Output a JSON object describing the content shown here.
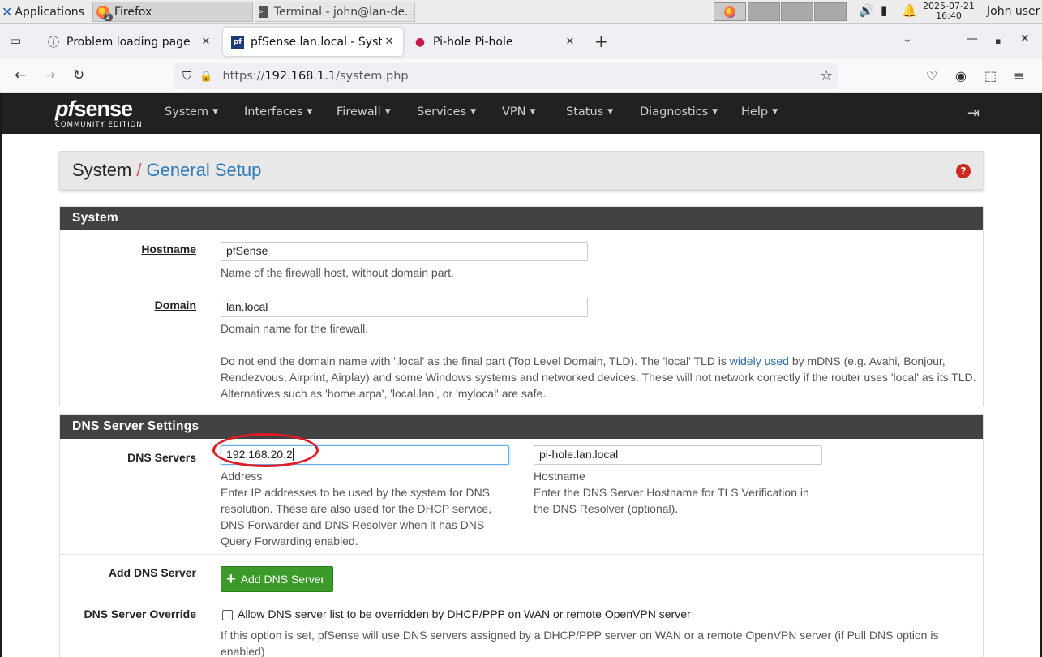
{
  "taskbar": {
    "apps_label": "Applications",
    "firefox_label": "Firefox",
    "firefox_count": "2",
    "terminal_label": "Terminal - john@lan-de...",
    "date": "2025-07-21",
    "time": "16:40",
    "user": "John user"
  },
  "browser": {
    "tabs": [
      {
        "title": "Problem loading page"
      },
      {
        "title": "pfSense.lan.local - System"
      },
      {
        "title": "Pi-hole Pi-hole"
      }
    ],
    "url_prefix": "https://",
    "url_host": "192.168.1.1",
    "url_path": "/system.php"
  },
  "pfsense": {
    "logo_word_a": "pf",
    "logo_word_b": "sense",
    "logo_edition": "COMMUNITY EDITION",
    "menu": [
      "System",
      "Interfaces",
      "Firewall",
      "Services",
      "VPN",
      "Status",
      "Diagnostics",
      "Help"
    ],
    "breadcrumb_parent": "System",
    "breadcrumb_sep": "/",
    "breadcrumb_current": "General Setup"
  },
  "system_panel": {
    "title": "System",
    "hostname_label": "Hostname",
    "hostname_value": "pfSense",
    "hostname_help": "Name of the firewall host, without domain part.",
    "domain_label": "Domain",
    "domain_value": "lan.local",
    "domain_help": "Domain name for the firewall.",
    "domain_warning_before": "Do not end the domain name with '.local' as the final part (Top Level Domain, TLD). The 'local' TLD is",
    "domain_warning_link": "widely used",
    "domain_warning_after": "by mDNS (e.g. Avahi, Bonjour, Rendezvous, Airprint, Airplay) and some Windows systems and networked devices. These will not network correctly if the router uses 'local' as its TLD. Alternatives such as 'home.arpa', 'local.lan', or 'mylocal' are safe."
  },
  "dns_panel": {
    "title": "DNS Server Settings",
    "servers_label": "DNS Servers",
    "address_value": "192.168.20.2",
    "address_caption": "Address",
    "address_help": "Enter IP addresses to be used by the system for DNS resolution. These are also used for the DHCP service, DNS Forwarder and DNS Resolver when it has DNS Query Forwarding enabled.",
    "hostname_value": "pi-hole.lan.local",
    "hostname_caption": "Hostname",
    "hostname_help": "Enter the DNS Server Hostname for TLS Verification in the DNS Resolver (optional).",
    "add_label": "Add DNS Server",
    "add_button": "Add DNS Server",
    "override_label": "DNS Server Override",
    "override_checkbox_text": "Allow DNS server list to be overridden by DHCP/PPP on WAN or remote OpenVPN server",
    "override_checked": false,
    "override_help": "If this option is set, pfSense will use DNS servers assigned by a DHCP/PPP server on WAN or a remote OpenVPN server (if Pull DNS option is enabled)"
  },
  "colors": {
    "nav_bg": "#212121",
    "panel_head_bg": "#424242",
    "link_blue": "#2e7ab8",
    "button_green": "#3c9a2b",
    "annotation_red": "#e01b24"
  }
}
